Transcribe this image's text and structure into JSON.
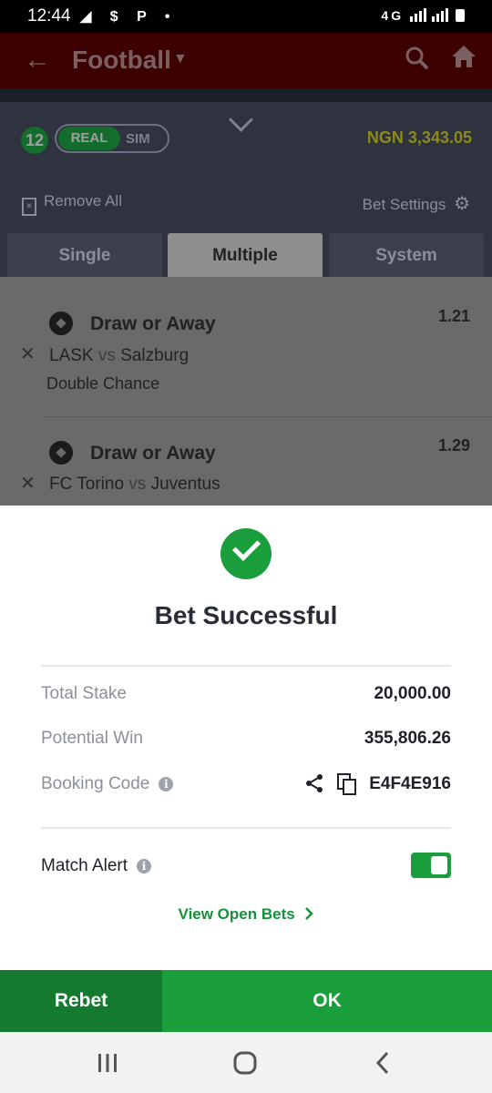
{
  "status_bar": {
    "time": "12:44",
    "left_icons": "◢ $ P •",
    "right_icons": "4G"
  },
  "header": {
    "title": "Football",
    "back_icon": "arrow-left-icon",
    "search_icon": "search-icon",
    "home_icon": "home-icon"
  },
  "betslip": {
    "count": "12",
    "mode_real": "REAL",
    "mode_sim": "SIM",
    "balance": "NGN 3,343.05",
    "remove_all": "Remove All",
    "bet_settings": "Bet Settings",
    "tabs": [
      {
        "label": "Single",
        "active": false
      },
      {
        "label": "Multiple",
        "active": true
      },
      {
        "label": "System",
        "active": false
      }
    ],
    "selections": [
      {
        "title": "Draw or Away",
        "home": "LASK",
        "vs": "vs",
        "away": "Salzburg",
        "market": "Double Chance",
        "odds": "1.21"
      },
      {
        "title": "Draw or Away",
        "home": "FC Torino",
        "vs": "vs",
        "away": "Juventus",
        "market": "",
        "odds": "1.29"
      }
    ]
  },
  "modal": {
    "title": "Bet Successful",
    "rows": [
      {
        "label": "Total Stake",
        "value": "20,000.00"
      },
      {
        "label": "Potential Win",
        "value": "355,806.26"
      },
      {
        "label": "Booking Code",
        "value": "E4F4E916"
      }
    ],
    "match_alert": "Match Alert",
    "match_alert_on": true,
    "view_open_bets": "View Open Bets",
    "rebet": "Rebet",
    "ok": "OK"
  },
  "colors": {
    "brand_green": "#1a9e3c",
    "dark_green": "#147a2f",
    "header_red": "#3d0000",
    "balance_yellow": "#8c8a18"
  }
}
